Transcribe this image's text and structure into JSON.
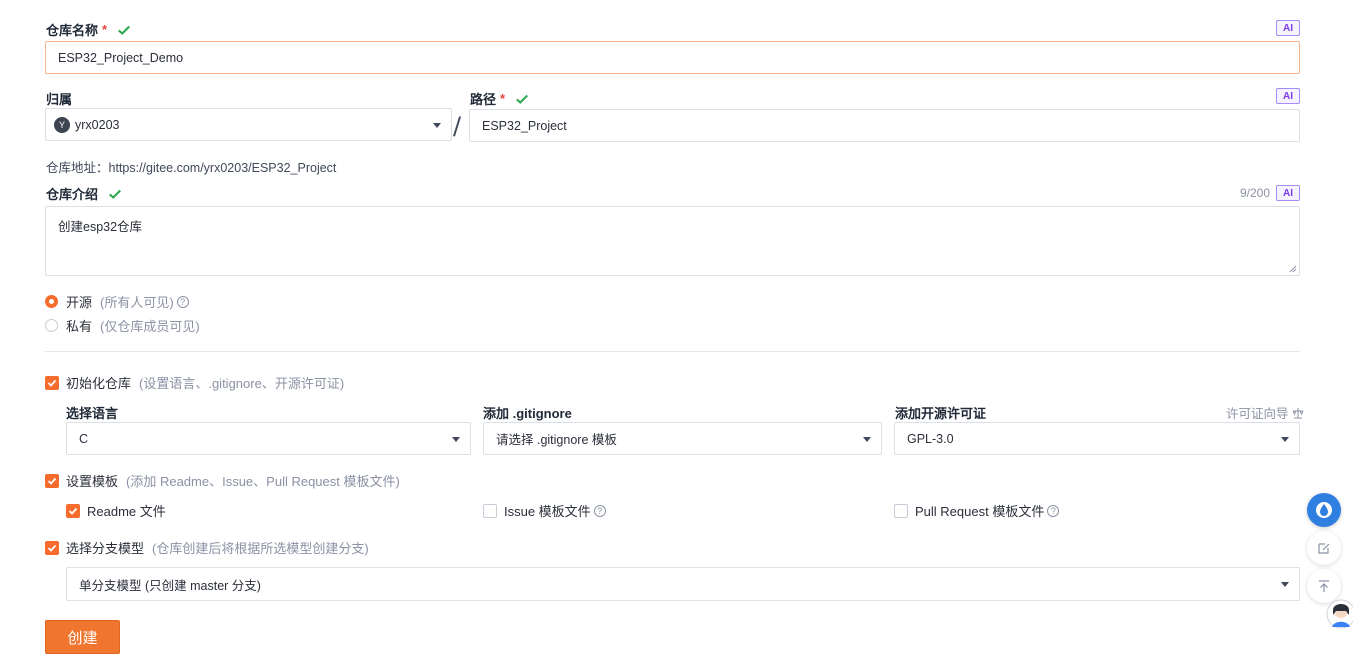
{
  "repo_name": {
    "label": "仓库名称",
    "required_mark": "*",
    "value": "ESP32_Project_Demo",
    "ai_badge": "AI"
  },
  "owner": {
    "label": "归属",
    "avatar_letter": "Y",
    "value": "yrx0203",
    "separator": "/"
  },
  "path": {
    "label": "路径",
    "required_mark": "*",
    "value": "ESP32_Project",
    "ai_badge": "AI"
  },
  "repo_address": "仓库地址：https://gitee.com/yrx0203/ESP32_Project",
  "description": {
    "label": "仓库介绍",
    "counter": "9/200",
    "ai_badge": "AI",
    "value": "创建esp32仓库"
  },
  "visibility": {
    "options": [
      {
        "label": "开源",
        "hint": "(所有人可见)",
        "selected": true,
        "help": "?"
      },
      {
        "label": "私有",
        "hint": "(仅仓库成员可见)",
        "selected": false
      }
    ]
  },
  "init_repo": {
    "label": "初始化仓库",
    "hint": "(设置语言、.gitignore、开源许可证)",
    "checked": true,
    "language": {
      "label": "选择语言",
      "value": "C"
    },
    "gitignore": {
      "label": "添加 .gitignore",
      "value": "请选择 .gitignore 模板"
    },
    "license": {
      "label": "添加开源许可证",
      "value": "GPL-3.0",
      "guide": "许可证向导"
    }
  },
  "templates": {
    "label": "设置模板",
    "hint": "(添加 Readme、Issue、Pull Request 模板文件)",
    "checked": true,
    "items": [
      {
        "label": "Readme 文件",
        "checked": true
      },
      {
        "label": "Issue 模板文件",
        "checked": false,
        "help": "?"
      },
      {
        "label": "Pull Request 模板文件",
        "checked": false,
        "help": "?"
      }
    ]
  },
  "branch_model": {
    "label": "选择分支模型",
    "hint": "(仓库创建后将根据所选模型创建分支)",
    "checked": true,
    "value": "单分支模型 (只创建 master 分支)"
  },
  "create_button": "创建",
  "colors": {
    "accent": "#f0762f",
    "ok": "#2fa84f",
    "ai": "#7c3aed"
  },
  "side_icons": [
    "assistant-drop-icon",
    "feedback-edit-icon",
    "back-to-top-icon",
    "avatar-icon"
  ]
}
